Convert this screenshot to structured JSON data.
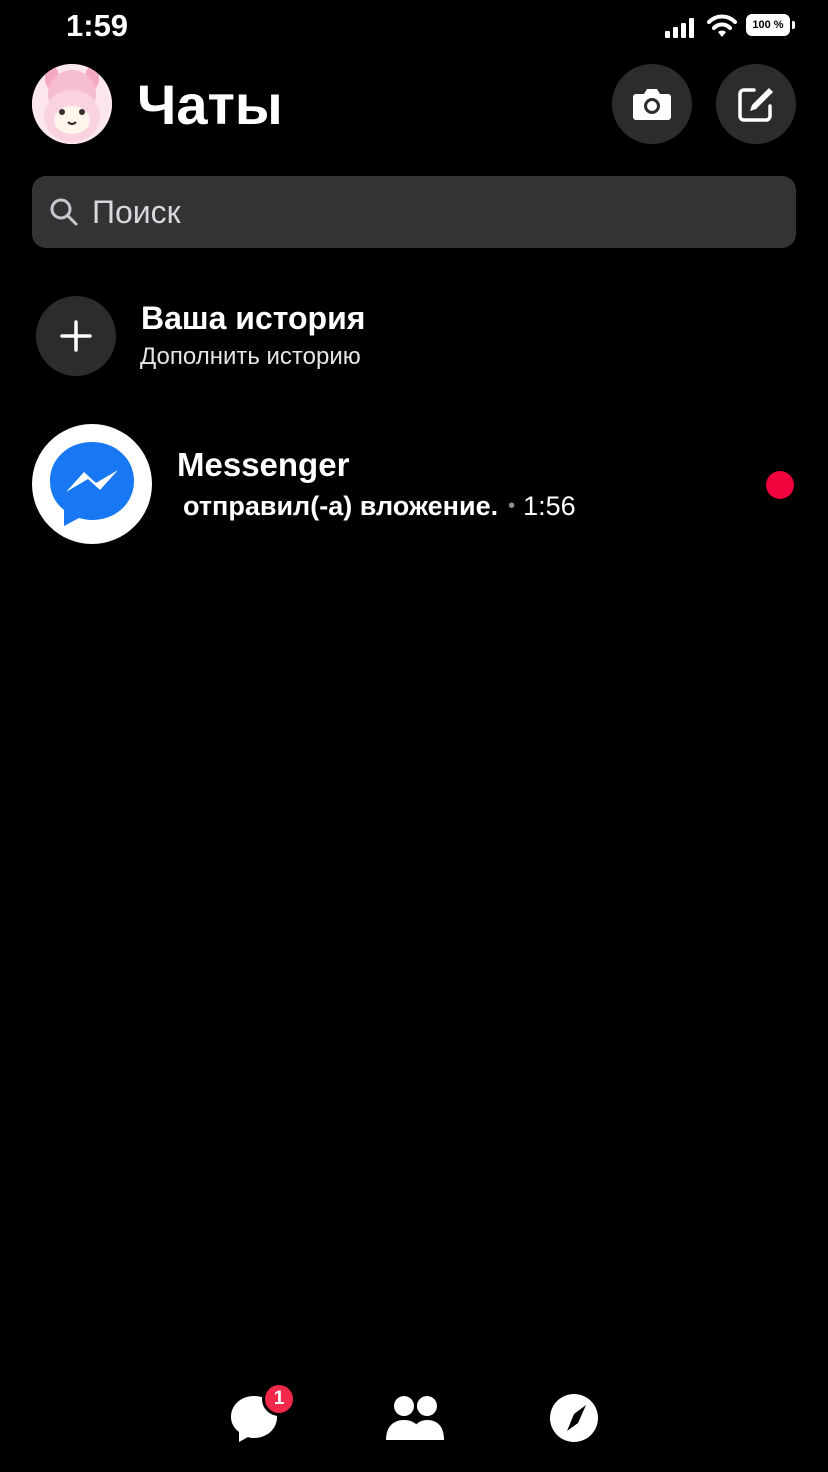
{
  "status_bar": {
    "time": "1:59",
    "battery": "100 %"
  },
  "header": {
    "title": "Чаты",
    "camera_icon": "camera-icon",
    "compose_icon": "compose-icon"
  },
  "search": {
    "placeholder": "Поиск",
    "value": ""
  },
  "story": {
    "title": "Ваша история",
    "subtitle": "Дополнить историю"
  },
  "chats": [
    {
      "name": "Messenger",
      "preview": "отправил(-а) вложение.",
      "time": "1:56",
      "unread": true
    }
  ],
  "bottom_nav": {
    "items": [
      {
        "icon": "chats-icon",
        "badge": "1"
      },
      {
        "icon": "people-icon"
      },
      {
        "icon": "discover-icon"
      }
    ]
  },
  "colors": {
    "background": "#000000",
    "control_bg": "#2c2c2e",
    "search_bg": "#333335",
    "messenger_blue": "#1877f2",
    "unread": "#f0023c",
    "badge": "#f02849"
  }
}
